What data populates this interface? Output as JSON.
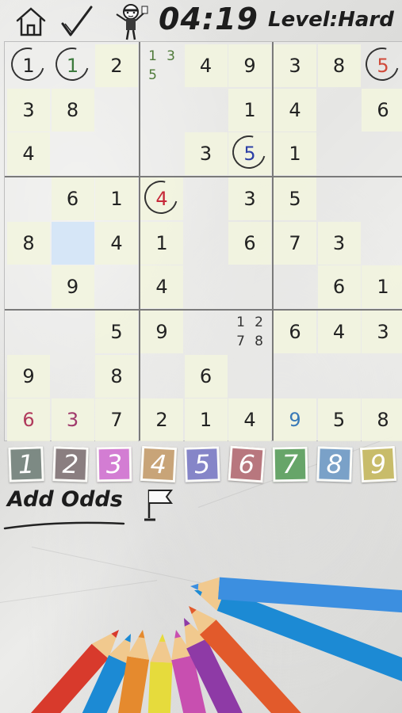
{
  "header": {
    "timer": "04:19",
    "level": "Level:Hard",
    "icons": [
      "home-icon",
      "check-icon",
      "mascot-icon"
    ]
  },
  "board": {
    "rows": [
      [
        "1",
        "1",
        "2",
        "",
        "4",
        "9",
        "3",
        "8",
        "5"
      ],
      [
        "3",
        "8",
        "",
        "",
        "",
        "1",
        "4",
        "",
        "6"
      ],
      [
        "4",
        "",
        "",
        "",
        "3",
        "5",
        "1",
        "",
        ""
      ],
      [
        "",
        "6",
        "1",
        "4",
        "",
        "3",
        "5",
        "",
        ""
      ],
      [
        "8",
        "",
        "4",
        "1",
        "",
        "6",
        "7",
        "3",
        ""
      ],
      [
        "",
        "9",
        "",
        "4",
        "",
        "",
        "",
        "6",
        "1"
      ],
      [
        "",
        "",
        "5",
        "9",
        "",
        "",
        "6",
        "4",
        "3"
      ],
      [
        "9",
        "",
        "8",
        "",
        "6",
        "",
        "",
        "",
        ""
      ],
      [
        "6",
        "3",
        "7",
        "2",
        "1",
        "4",
        "9",
        "5",
        "8"
      ]
    ],
    "notes": [
      {
        "row": 0,
        "col": 3,
        "values": [
          "1",
          "3",
          "5",
          ""
        ],
        "color": "#4f7a3a"
      },
      {
        "row": 6,
        "col": 5,
        "values": [
          "1",
          "2",
          "7",
          "8"
        ],
        "color": "#333333"
      }
    ],
    "tinted": [
      [
        0,
        2
      ],
      [
        0,
        4
      ],
      [
        0,
        5
      ],
      [
        0,
        6
      ],
      [
        0,
        7
      ],
      [
        1,
        0
      ],
      [
        1,
        1
      ],
      [
        1,
        5
      ],
      [
        1,
        6
      ],
      [
        1,
        8
      ],
      [
        2,
        0
      ],
      [
        2,
        4
      ],
      [
        2,
        5
      ],
      [
        2,
        6
      ],
      [
        3,
        1
      ],
      [
        3,
        2
      ],
      [
        3,
        3
      ],
      [
        3,
        5
      ],
      [
        3,
        6
      ],
      [
        4,
        0
      ],
      [
        4,
        2
      ],
      [
        4,
        3
      ],
      [
        4,
        5
      ],
      [
        4,
        6
      ],
      [
        4,
        7
      ],
      [
        5,
        1
      ],
      [
        5,
        3
      ],
      [
        5,
        7
      ],
      [
        5,
        8
      ],
      [
        6,
        2
      ],
      [
        6,
        3
      ],
      [
        6,
        6
      ],
      [
        6,
        7
      ],
      [
        6,
        8
      ],
      [
        7,
        0
      ],
      [
        7,
        2
      ],
      [
        7,
        4
      ],
      [
        8,
        0
      ],
      [
        8,
        1
      ],
      [
        8,
        2
      ],
      [
        8,
        3
      ],
      [
        8,
        4
      ],
      [
        8,
        5
      ],
      [
        8,
        6
      ],
      [
        8,
        7
      ],
      [
        8,
        8
      ]
    ],
    "selected": [
      4,
      1
    ],
    "circled": [
      [
        0,
        0
      ],
      [
        0,
        1
      ],
      [
        0,
        8
      ],
      [
        2,
        5
      ],
      [
        3,
        3
      ]
    ],
    "colored_digits": [
      {
        "row": 0,
        "col": 1,
        "color": "#3d7a3d"
      },
      {
        "row": 0,
        "col": 8,
        "color": "#d04a3a"
      },
      {
        "row": 2,
        "col": 5,
        "color": "#2c3fa6"
      },
      {
        "row": 3,
        "col": 3,
        "color": "#c62838"
      },
      {
        "row": 8,
        "col": 0,
        "color": "#b03a5c"
      },
      {
        "row": 8,
        "col": 1,
        "color": "#a03a6c"
      },
      {
        "row": 8,
        "col": 6,
        "color": "#3a7ab8"
      }
    ]
  },
  "palette": [
    {
      "digit": "1",
      "color": "#7d8a84"
    },
    {
      "digit": "2",
      "color": "#8a7e80"
    },
    {
      "digit": "3",
      "color": "#d37dd3"
    },
    {
      "digit": "4",
      "color": "#c8a478"
    },
    {
      "digit": "5",
      "color": "#8585c8"
    },
    {
      "digit": "6",
      "color": "#b8777e"
    },
    {
      "digit": "7",
      "color": "#67a569"
    },
    {
      "digit": "8",
      "color": "#7aa1c8"
    },
    {
      "digit": "9",
      "color": "#c8bc6a"
    }
  ],
  "footer": {
    "add_odds": "Add Odds",
    "flag_icon": "flag-icon"
  },
  "pencil_colors": [
    "#d83a2c",
    "#e58a2e",
    "#f0b73a",
    "#e6db3c",
    "#8bc34a",
    "#c84fb0",
    "#8e3aa6",
    "#e25a2b",
    "#1c8ad4",
    "#3c8fe0"
  ]
}
